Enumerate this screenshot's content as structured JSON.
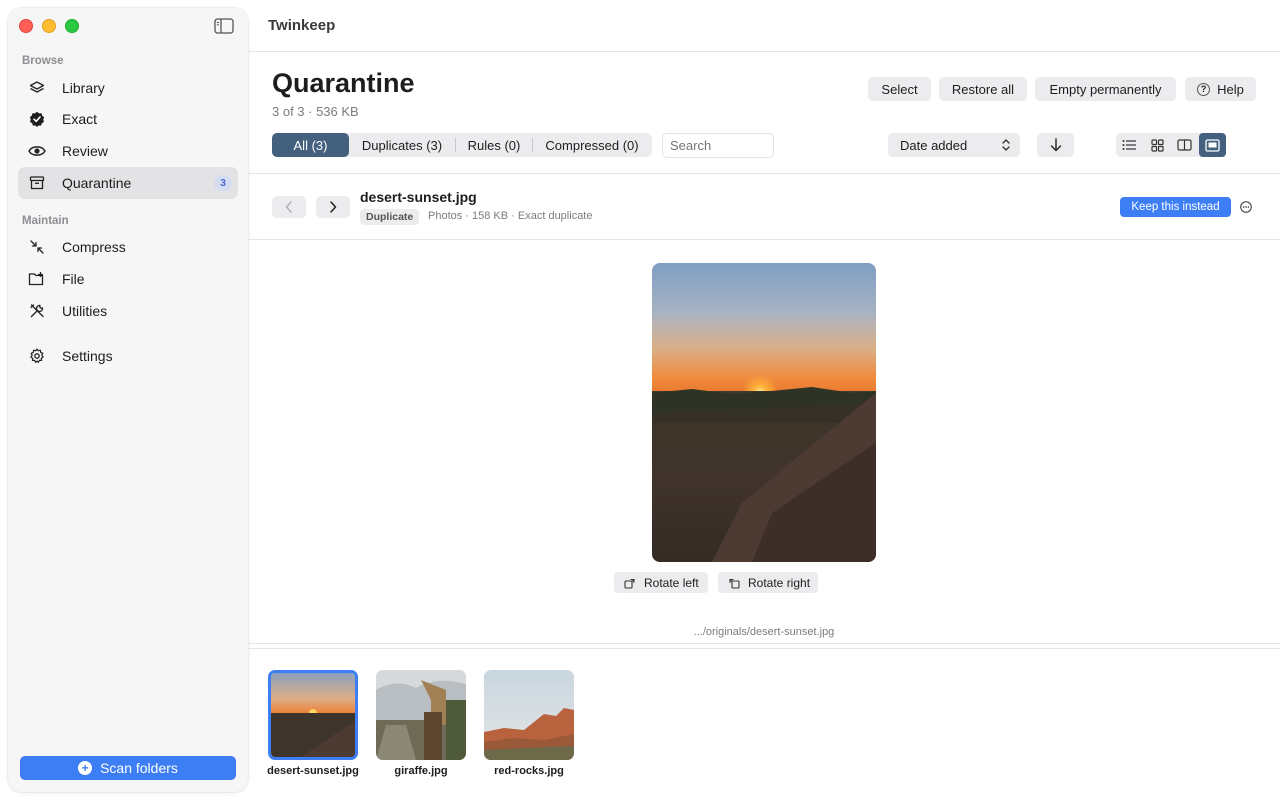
{
  "app": {
    "title": "Twinkeep"
  },
  "sidebar": {
    "browse_label": "Browse",
    "maintain_label": "Maintain",
    "items": [
      {
        "label": "Library",
        "icon": "layers-icon"
      },
      {
        "label": "Exact",
        "icon": "verified-badge-icon"
      },
      {
        "label": "Review",
        "icon": "eye-icon"
      },
      {
        "label": "Quarantine",
        "icon": "archive-box-icon",
        "badge": "3"
      },
      {
        "label": "Compress",
        "icon": "compress-arrows-icon"
      },
      {
        "label": "File",
        "icon": "folder-icon"
      },
      {
        "label": "Utilities",
        "icon": "tools-icon"
      },
      {
        "label": "Settings",
        "icon": "gear-icon"
      }
    ],
    "scan_button": "Scan folders"
  },
  "header": {
    "title": "Quarantine",
    "subtitle": "3 of 3 · 536 KB",
    "actions": {
      "select": "Select",
      "restore_all": "Restore all",
      "empty": "Empty permanently",
      "help": "Help"
    }
  },
  "filters": {
    "tabs": [
      {
        "label": "All (3)",
        "selected": true
      },
      {
        "label": "Duplicates (3)"
      },
      {
        "label": "Rules (0)"
      },
      {
        "label": "Compressed (0)"
      }
    ],
    "search_placeholder": "Search",
    "sort_value": "Date added",
    "sort_direction": "descending",
    "view_mode": "filmstrip"
  },
  "detail": {
    "file_name": "desert-sunset.jpg",
    "tag": "Duplicate",
    "meta": "Photos · 158 KB · Exact duplicate",
    "keep_button": "Keep this instead",
    "rotate_left": "Rotate left",
    "rotate_right": "Rotate right",
    "path": ".../originals/desert-sunset.jpg"
  },
  "filmstrip": [
    {
      "label": "desert-sunset.jpg",
      "selected": true
    },
    {
      "label": "giraffe.jpg"
    },
    {
      "label": "red-rocks.jpg"
    }
  ],
  "colors": {
    "accent": "#3d7ef5",
    "selected_segment": "#43607f"
  }
}
